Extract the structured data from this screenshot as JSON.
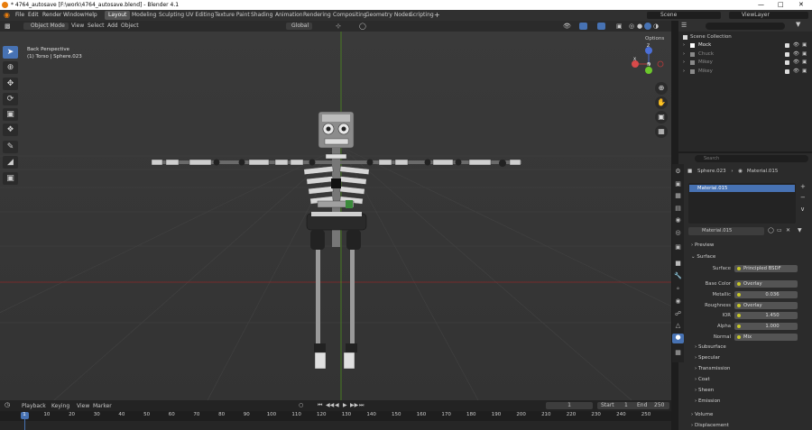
{
  "window": {
    "title": "* 4764_autosave [F:\\work\\4764_autosave.blend] - Blender 4.1"
  },
  "menu": [
    "File",
    "Edit",
    "Render",
    "Window",
    "Help"
  ],
  "workspaces": [
    "Layout",
    "Modeling",
    "Sculpting",
    "UV Editing",
    "Texture Paint",
    "Shading",
    "Animation",
    "Rendering",
    "Compositing",
    "Geometry Nodes",
    "Scripting"
  ],
  "scene_selector": {
    "scene": "Scene",
    "view_layer": "ViewLayer"
  },
  "viewport": {
    "mode": "Object Mode",
    "menus": [
      "View",
      "Select",
      "Add",
      "Object"
    ],
    "orientation": "Global",
    "options_label": "Options",
    "overlay_title": "Back Perspective",
    "overlay_object": "(1) Torso | Sphere.023",
    "gizmo_axes": {
      "x": "X",
      "y": "Y",
      "z": "Z"
    }
  },
  "outliner": {
    "search_placeholder": "",
    "root": "Scene Collection",
    "items": [
      {
        "name": "Mock",
        "color": "#ffffff",
        "muted": false
      },
      {
        "name": "Chuck",
        "color": "#8a8a8a",
        "muted": true
      },
      {
        "name": "Mikey",
        "color": "#8a8a8a",
        "muted": true
      },
      {
        "name": "Mikey",
        "color": "#8a8a8a",
        "muted": true
      }
    ]
  },
  "properties": {
    "search_placeholder": "Search",
    "breadcrumb_object": "Sphere.023",
    "breadcrumb_material": "Material.015",
    "slot": "Material.015",
    "material_name": "Material.015",
    "sections": {
      "preview": "Preview",
      "surface": "Surface"
    },
    "fields": [
      {
        "label": "Surface",
        "value": "Principled BSDF"
      },
      {
        "label": "Base Color",
        "value": "Overlay"
      },
      {
        "label": "Metallic",
        "value": "0.036"
      },
      {
        "label": "Roughness",
        "value": "Overlay"
      },
      {
        "label": "IOR",
        "value": "1.450"
      },
      {
        "label": "Alpha",
        "value": "1.000"
      },
      {
        "label": "Normal",
        "value": "Mix"
      }
    ],
    "subsections": [
      "Subsurface",
      "Specular",
      "Transmission",
      "Coat",
      "Sheen",
      "Emission",
      "Volume",
      "Displacement"
    ]
  },
  "timeline": {
    "menus": [
      "Playback",
      "Keying",
      "View",
      "Marker"
    ],
    "current_frame": "1",
    "start_label": "Start",
    "start": "1",
    "end_label": "End",
    "end": "250",
    "ticks": [
      "1",
      "10",
      "20",
      "30",
      "40",
      "50",
      "60",
      "70",
      "80",
      "90",
      "100",
      "110",
      "120",
      "130",
      "140",
      "150",
      "160",
      "170",
      "180",
      "190",
      "200",
      "210",
      "220",
      "230",
      "240",
      "250"
    ]
  },
  "colors": {
    "accent": "#4772b3",
    "header": "#303030",
    "viewport": "#393939",
    "x_axis": "#8b2a2a",
    "y_axis": "#4f8f1f"
  }
}
